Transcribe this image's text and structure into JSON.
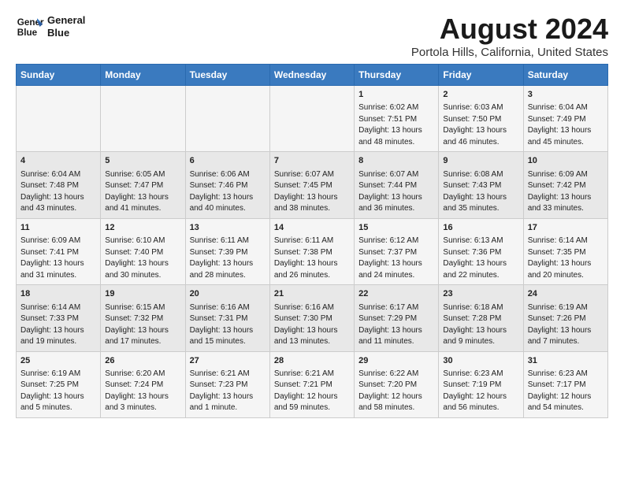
{
  "logo": {
    "line1": "General",
    "line2": "Blue"
  },
  "title": "August 2024",
  "subtitle": "Portola Hills, California, United States",
  "weekdays": [
    "Sunday",
    "Monday",
    "Tuesday",
    "Wednesday",
    "Thursday",
    "Friday",
    "Saturday"
  ],
  "weeks": [
    [
      {
        "day": "",
        "content": ""
      },
      {
        "day": "",
        "content": ""
      },
      {
        "day": "",
        "content": ""
      },
      {
        "day": "",
        "content": ""
      },
      {
        "day": "1",
        "content": "Sunrise: 6:02 AM\nSunset: 7:51 PM\nDaylight: 13 hours\nand 48 minutes."
      },
      {
        "day": "2",
        "content": "Sunrise: 6:03 AM\nSunset: 7:50 PM\nDaylight: 13 hours\nand 46 minutes."
      },
      {
        "day": "3",
        "content": "Sunrise: 6:04 AM\nSunset: 7:49 PM\nDaylight: 13 hours\nand 45 minutes."
      }
    ],
    [
      {
        "day": "4",
        "content": "Sunrise: 6:04 AM\nSunset: 7:48 PM\nDaylight: 13 hours\nand 43 minutes."
      },
      {
        "day": "5",
        "content": "Sunrise: 6:05 AM\nSunset: 7:47 PM\nDaylight: 13 hours\nand 41 minutes."
      },
      {
        "day": "6",
        "content": "Sunrise: 6:06 AM\nSunset: 7:46 PM\nDaylight: 13 hours\nand 40 minutes."
      },
      {
        "day": "7",
        "content": "Sunrise: 6:07 AM\nSunset: 7:45 PM\nDaylight: 13 hours\nand 38 minutes."
      },
      {
        "day": "8",
        "content": "Sunrise: 6:07 AM\nSunset: 7:44 PM\nDaylight: 13 hours\nand 36 minutes."
      },
      {
        "day": "9",
        "content": "Sunrise: 6:08 AM\nSunset: 7:43 PM\nDaylight: 13 hours\nand 35 minutes."
      },
      {
        "day": "10",
        "content": "Sunrise: 6:09 AM\nSunset: 7:42 PM\nDaylight: 13 hours\nand 33 minutes."
      }
    ],
    [
      {
        "day": "11",
        "content": "Sunrise: 6:09 AM\nSunset: 7:41 PM\nDaylight: 13 hours\nand 31 minutes."
      },
      {
        "day": "12",
        "content": "Sunrise: 6:10 AM\nSunset: 7:40 PM\nDaylight: 13 hours\nand 30 minutes."
      },
      {
        "day": "13",
        "content": "Sunrise: 6:11 AM\nSunset: 7:39 PM\nDaylight: 13 hours\nand 28 minutes."
      },
      {
        "day": "14",
        "content": "Sunrise: 6:11 AM\nSunset: 7:38 PM\nDaylight: 13 hours\nand 26 minutes."
      },
      {
        "day": "15",
        "content": "Sunrise: 6:12 AM\nSunset: 7:37 PM\nDaylight: 13 hours\nand 24 minutes."
      },
      {
        "day": "16",
        "content": "Sunrise: 6:13 AM\nSunset: 7:36 PM\nDaylight: 13 hours\nand 22 minutes."
      },
      {
        "day": "17",
        "content": "Sunrise: 6:14 AM\nSunset: 7:35 PM\nDaylight: 13 hours\nand 20 minutes."
      }
    ],
    [
      {
        "day": "18",
        "content": "Sunrise: 6:14 AM\nSunset: 7:33 PM\nDaylight: 13 hours\nand 19 minutes."
      },
      {
        "day": "19",
        "content": "Sunrise: 6:15 AM\nSunset: 7:32 PM\nDaylight: 13 hours\nand 17 minutes."
      },
      {
        "day": "20",
        "content": "Sunrise: 6:16 AM\nSunset: 7:31 PM\nDaylight: 13 hours\nand 15 minutes."
      },
      {
        "day": "21",
        "content": "Sunrise: 6:16 AM\nSunset: 7:30 PM\nDaylight: 13 hours\nand 13 minutes."
      },
      {
        "day": "22",
        "content": "Sunrise: 6:17 AM\nSunset: 7:29 PM\nDaylight: 13 hours\nand 11 minutes."
      },
      {
        "day": "23",
        "content": "Sunrise: 6:18 AM\nSunset: 7:28 PM\nDaylight: 13 hours\nand 9 minutes."
      },
      {
        "day": "24",
        "content": "Sunrise: 6:19 AM\nSunset: 7:26 PM\nDaylight: 13 hours\nand 7 minutes."
      }
    ],
    [
      {
        "day": "25",
        "content": "Sunrise: 6:19 AM\nSunset: 7:25 PM\nDaylight: 13 hours\nand 5 minutes."
      },
      {
        "day": "26",
        "content": "Sunrise: 6:20 AM\nSunset: 7:24 PM\nDaylight: 13 hours\nand 3 minutes."
      },
      {
        "day": "27",
        "content": "Sunrise: 6:21 AM\nSunset: 7:23 PM\nDaylight: 13 hours\nand 1 minute."
      },
      {
        "day": "28",
        "content": "Sunrise: 6:21 AM\nSunset: 7:21 PM\nDaylight: 12 hours\nand 59 minutes."
      },
      {
        "day": "29",
        "content": "Sunrise: 6:22 AM\nSunset: 7:20 PM\nDaylight: 12 hours\nand 58 minutes."
      },
      {
        "day": "30",
        "content": "Sunrise: 6:23 AM\nSunset: 7:19 PM\nDaylight: 12 hours\nand 56 minutes."
      },
      {
        "day": "31",
        "content": "Sunrise: 6:23 AM\nSunset: 7:17 PM\nDaylight: 12 hours\nand 54 minutes."
      }
    ]
  ]
}
